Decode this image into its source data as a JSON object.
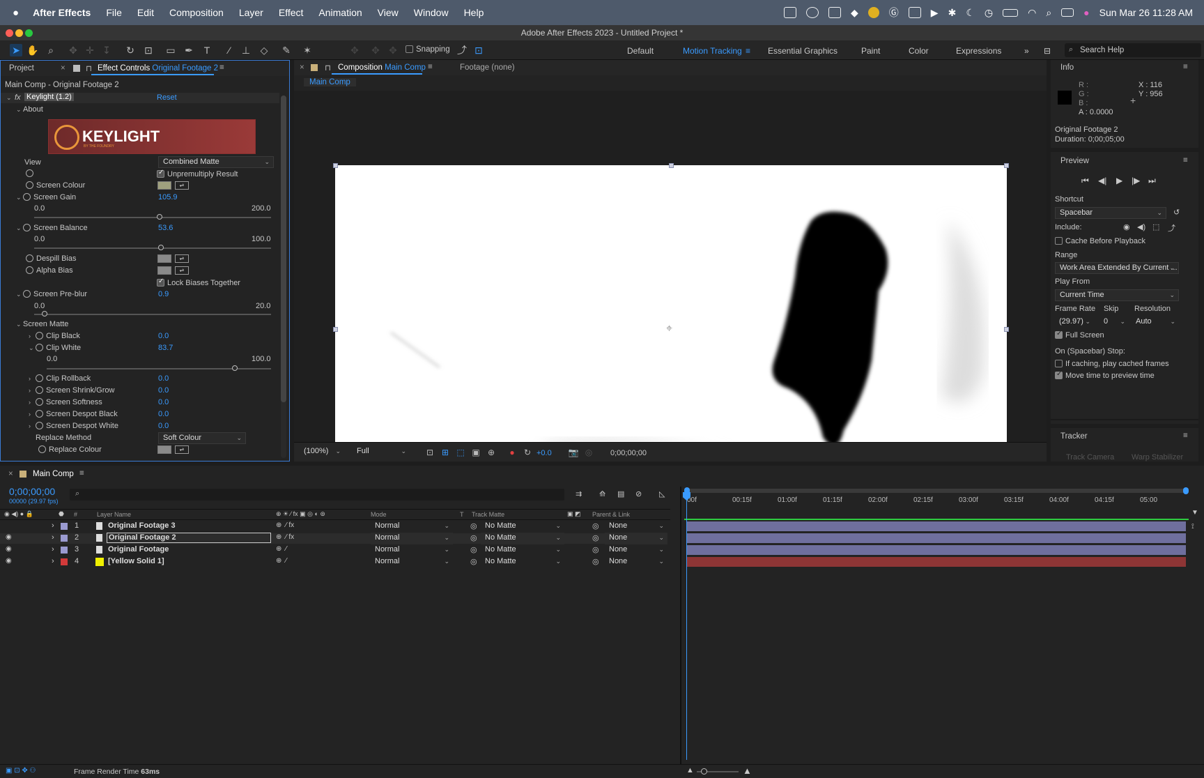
{
  "menubar": {
    "app": "After Effects",
    "items": [
      "File",
      "Edit",
      "Composition",
      "Layer",
      "Effect",
      "Animation",
      "View",
      "Window",
      "Help"
    ],
    "datetime": "Sun Mar 26  11:28 AM"
  },
  "window": {
    "title": "Adobe After Effects 2023 - Untitled Project *"
  },
  "toolbar": {
    "snapping": "Snapping",
    "workspaces": [
      "Default",
      "Motion Tracking",
      "Essential Graphics",
      "Paint",
      "Color",
      "Expressions"
    ],
    "active_workspace": "Motion Tracking",
    "search_placeholder": "Search Help"
  },
  "effect_panel": {
    "tab_project": "Project",
    "tab_effect_prefix": "Effect Controls",
    "tab_effect_layer": "Original Footage 2",
    "breadcrumb": "Main Comp - Original Footage 2",
    "fx_label": "fx",
    "effect_name": "Keylight (1.2)",
    "reset": "Reset",
    "about": "About",
    "logo_text": "KEYLIGHT",
    "logo_sub": "BY THE FOUNDRY",
    "view_label": "View",
    "view_value": "Combined Matte",
    "unpremultiply": "Unpremultiply Result",
    "screen_colour": "Screen Colour",
    "screen_gain": "Screen Gain",
    "screen_gain_value": "105.9",
    "screen_gain_min": "0.0",
    "screen_gain_max": "200.0",
    "screen_gain_level": 0.5295,
    "screen_balance": "Screen Balance",
    "screen_balance_value": "53.6",
    "screen_balance_min": "0.0",
    "screen_balance_max": "100.0",
    "screen_balance_level": 0.536,
    "despill_bias": "Despill Bias",
    "alpha_bias": "Alpha Bias",
    "lock_biases": "Lock Biases Together",
    "pre_blur": "Screen Pre-blur",
    "pre_blur_value": "0.9",
    "pre_blur_min": "0.0",
    "pre_blur_max": "20.0",
    "pre_blur_level": 0.045,
    "screen_matte": "Screen Matte",
    "clip_black": "Clip Black",
    "clip_black_value": "0.0",
    "clip_white": "Clip White",
    "clip_white_value": "83.7",
    "clip_white_min": "0.0",
    "clip_white_max": "100.0",
    "clip_white_level": 0.837,
    "clip_rollback": "Clip Rollback",
    "clip_rollback_value": "0.0",
    "shrink_grow": "Screen Shrink/Grow",
    "shrink_grow_value": "0.0",
    "softness": "Screen Softness",
    "softness_value": "0.0",
    "despot_black": "Screen Despot Black",
    "despot_black_value": "0.0",
    "despot_white": "Screen Despot White",
    "despot_white_value": "0.0",
    "replace_method": "Replace Method",
    "replace_method_value": "Soft Colour",
    "replace_colour": "Replace Colour"
  },
  "comp_panel": {
    "tab_prefix": "Composition",
    "tab_comp": "Main Comp",
    "tab_footage": "Footage (none)",
    "subtab": "Main Comp",
    "zoom": "(100%)",
    "resolution": "Full",
    "exposure": "+0.0",
    "timecode": "0;00;00;00"
  },
  "info_panel": {
    "title": "Info",
    "r": "R :",
    "g": "G :",
    "b": "B :",
    "a": "A :  0.0000",
    "x": "X : 116",
    "y": "Y : 956",
    "layer": "Original Footage 2",
    "duration": "Duration: 0;00;05;00"
  },
  "preview_panel": {
    "title": "Preview",
    "shortcut_label": "Shortcut",
    "shortcut_value": "Spacebar",
    "include_label": "Include:",
    "cache": "Cache Before Playback",
    "range_label": "Range",
    "range_value": "Work Area Extended By Current ...",
    "play_from_label": "Play From",
    "play_from_value": "Current Time",
    "frame_rate_label": "Frame Rate",
    "skip_label": "Skip",
    "resolution_label": "Resolution",
    "frame_rate_value": "(29.97)",
    "skip_value": "0",
    "resolution_value": "Auto",
    "full_screen": "Full Screen",
    "stop_label": "On (Spacebar) Stop:",
    "if_caching": "If caching, play cached frames",
    "move_time": "Move time to preview time"
  },
  "tracker_panel": {
    "title": "Tracker",
    "track_camera": "Track Camera",
    "warp_stabilizer": "Warp Stabilizer"
  },
  "timeline": {
    "tab": "Main Comp",
    "timecode": "0;00;00;00",
    "fps": "00000 (29.97 fps)",
    "col_hash": "#",
    "col_layer": "Layer Name",
    "col_mode": "Mode",
    "col_t": "T",
    "col_track": "Track Matte",
    "col_parent": "Parent & Link",
    "ruler": [
      "00f",
      "00:15f",
      "01:00f",
      "01:15f",
      "02:00f",
      "02:15f",
      "03:00f",
      "03:15f",
      "04:00f",
      "04:15f",
      "05:00"
    ],
    "layers": [
      {
        "num": "1",
        "name": "Original Footage 3",
        "mode": "Normal",
        "matte": "No Matte",
        "parent": "None",
        "label": "#9a9ad0",
        "bar": "#6f6f9e"
      },
      {
        "num": "2",
        "name": "Original Footage 2",
        "mode": "Normal",
        "matte": "No Matte",
        "parent": "None",
        "label": "#9a9ad0",
        "bar": "#6f6f9e"
      },
      {
        "num": "3",
        "name": "Original Footage",
        "mode": "Normal",
        "matte": "No Matte",
        "parent": "None",
        "label": "#9a9ad0",
        "bar": "#6f6f9e"
      },
      {
        "num": "4",
        "name": "[Yellow Solid 1]",
        "mode": "Normal",
        "matte": "No Matte",
        "parent": "None",
        "label": "#d23a3a",
        "bar": "#8e3535"
      }
    ]
  },
  "status": {
    "label": "Frame Render Time",
    "value": "63ms"
  },
  "colors": {
    "accent": "#3a9bff",
    "timeline_green": "#2ecc40"
  }
}
